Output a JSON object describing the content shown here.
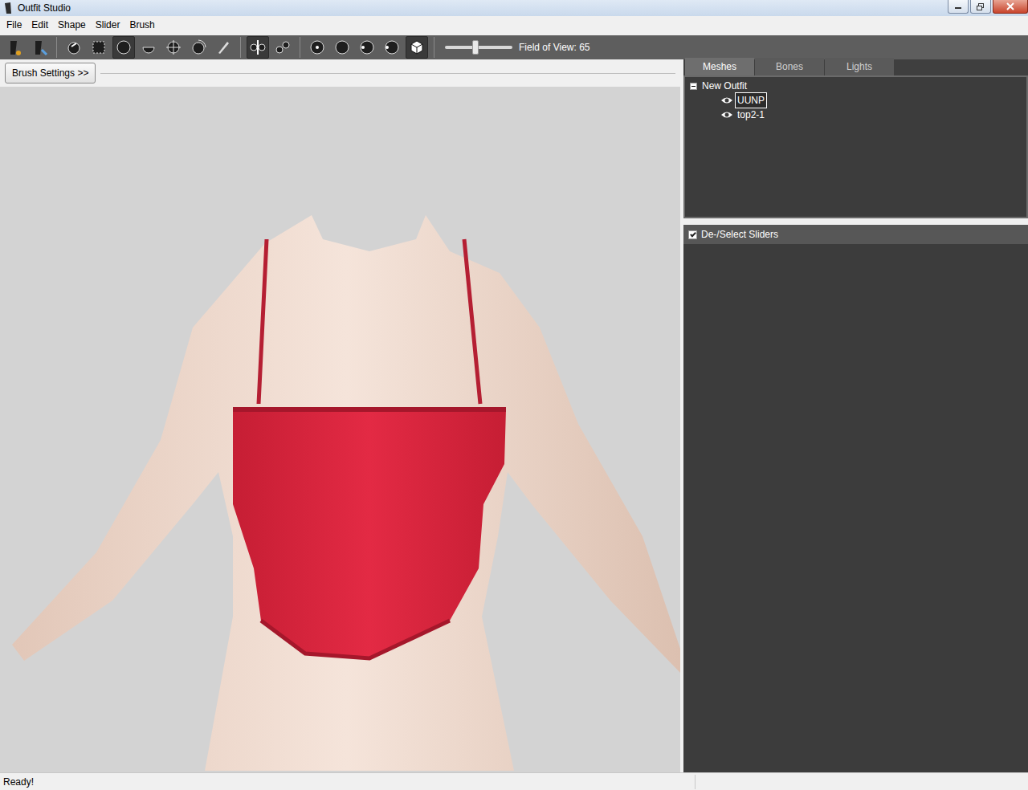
{
  "window": {
    "title": "Outfit Studio"
  },
  "menu": [
    "File",
    "Edit",
    "Shape",
    "Slider",
    "Brush"
  ],
  "toolbar": [
    [
      {
        "selected": false
      },
      {
        "selected": false
      }
    ],
    [
      {
        "selected": false
      },
      {
        "selected": false
      },
      {
        "selected": true
      },
      {
        "selected": false
      },
      {
        "selected": false
      },
      {
        "selected": false
      },
      {
        "selected": false
      }
    ],
    [
      {
        "selected": true
      },
      {
        "selected": false
      }
    ],
    [
      {
        "selected": false
      },
      {
        "selected": false
      },
      {
        "selected": false
      },
      {
        "selected": false
      },
      {
        "selected": true
      }
    ]
  ],
  "fov": {
    "label": "Field of View: 65",
    "level": 0.45
  },
  "brush_settings": "Brush Settings >>",
  "tabs": [
    {
      "label": "Meshes",
      "selected": true
    },
    {
      "label": "Bones",
      "selected": false
    },
    {
      "label": "Lights",
      "selected": false
    }
  ],
  "tree": {
    "root": {
      "label": "New Outfit",
      "expanded": true
    },
    "items": [
      {
        "label": "UUNP",
        "visible": true,
        "selected": true
      },
      {
        "label": "top2-1",
        "visible": true,
        "selected": false
      }
    ]
  },
  "sliders": {
    "label": "De-/Select Sliders",
    "checked": true
  },
  "status_bar": [
    "Ready!"
  ]
}
